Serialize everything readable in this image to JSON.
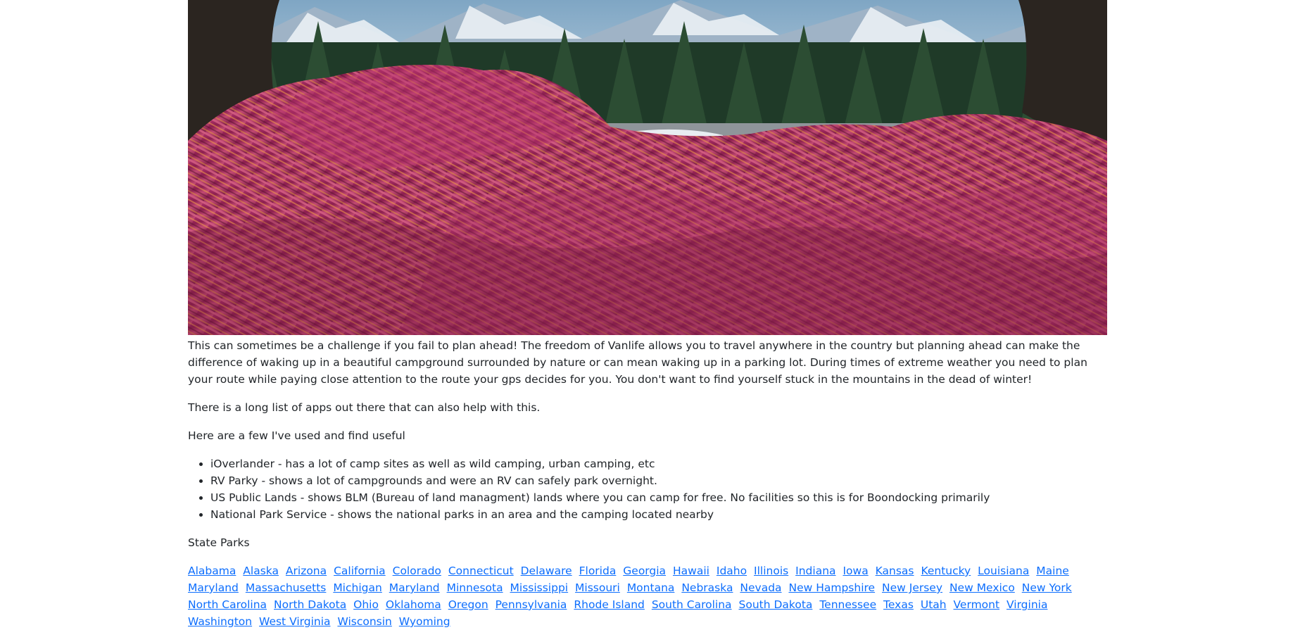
{
  "hero_image": {
    "icon": "van-bed-mountain-view-photo"
  },
  "paragraphs": {
    "intro": "This can sometimes be a challenge if you fail to plan ahead! The freedom of Vanlife allows you to travel anywhere in the country but planning ahead can make the difference of waking up in a beautiful campground surrounded by nature or can mean waking up in a parking lot. During times of extreme weather you need to plan your route while paying close attention to the route your gps decides for you. You don't want to find yourself stuck in the mountains in the dead of winter!",
    "apps_list_intro": "There is a long list of apps out there that can also help with this.",
    "useful_intro": "Here are a few I've used and find useful",
    "state_parks_heading": "State Parks"
  },
  "apps": [
    "iOverlander - has a lot of camp sites as well as wild camping, urban camping, etc",
    "RV Parky - shows a lot of campgrounds and were an RV can safely park overnight.",
    "US Public Lands - shows BLM (Bureau of land managment) lands where you can camp for free. No facilities so this is for Boondocking primarily",
    "National Park Service - shows the national parks in an area and the camping located nearby"
  ],
  "states": [
    "Alabama",
    "Alaska",
    "Arizona",
    "California",
    "Colorado",
    "Connecticut",
    "Delaware",
    "Florida",
    "Georgia",
    "Hawaii",
    "Idaho",
    "Illinois",
    "Indiana",
    "Iowa",
    "Kansas",
    "Kentucky",
    "Louisiana",
    "Maine",
    "Maryland",
    "Massachusetts",
    "Michigan",
    "Maryland",
    "Minnesota",
    "Mississippi",
    "Missouri",
    "Montana",
    "Nebraska",
    "Nevada",
    "New Hampshire",
    "New Jersey",
    "New Mexico",
    "New York",
    "North Carolina",
    "North Dakota",
    "Ohio",
    "Oklahoma",
    "Oregon",
    "Pennsylvania",
    "Rhode Island",
    "South Carolina",
    "South Dakota",
    "Tennessee",
    "Texas",
    "Utah",
    "Vermont",
    "Virginia",
    "Washington",
    "West Virginia",
    "Wisconsin",
    "Wyoming"
  ],
  "colors": {
    "text": "#212529",
    "link": "#0d6efd"
  }
}
